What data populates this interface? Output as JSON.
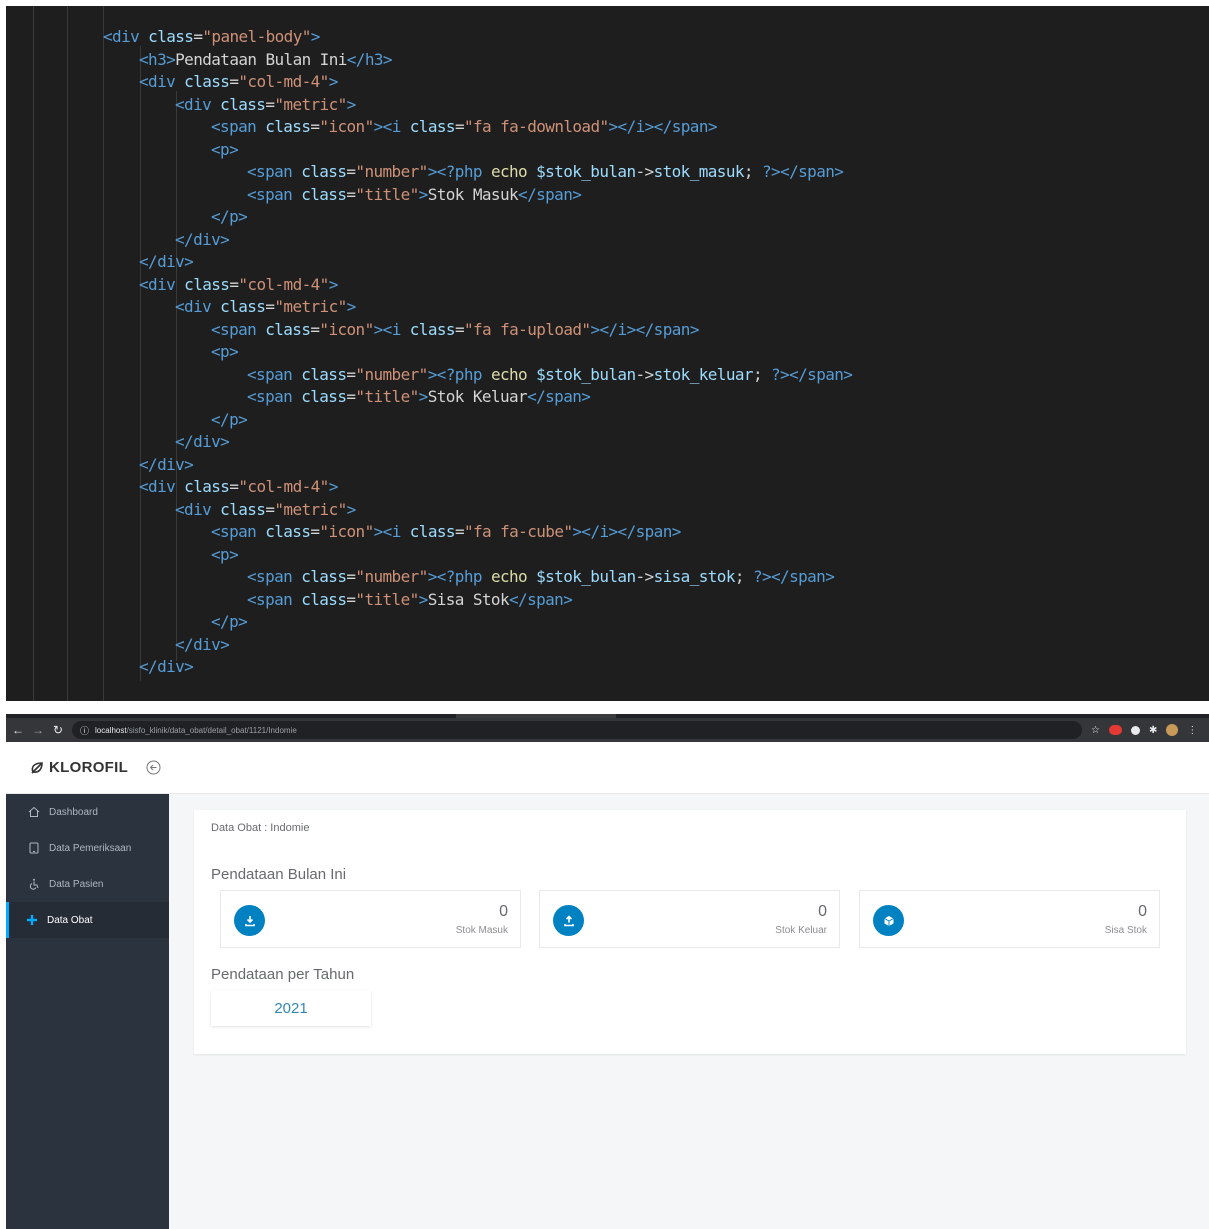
{
  "editor": {
    "lines": [
      [
        [
          "tok-tag",
          "<div "
        ],
        [
          "tok-attr",
          "class"
        ],
        [
          "tok-txt",
          "="
        ],
        [
          "tok-str",
          "\"panel-body\""
        ],
        [
          "tok-tag",
          ">"
        ]
      ],
      [
        [
          "tok-tag",
          "<h3>"
        ],
        [
          "tok-txt",
          "Pendataan Bulan Ini"
        ],
        [
          "tok-tag",
          "</h3>"
        ]
      ],
      [
        [
          "tok-tag",
          "<div "
        ],
        [
          "tok-attr",
          "class"
        ],
        [
          "tok-txt",
          "="
        ],
        [
          "tok-str",
          "\"col-md-4\""
        ],
        [
          "tok-tag",
          ">"
        ]
      ],
      [
        [
          "tok-tag",
          "<div "
        ],
        [
          "tok-attr",
          "class"
        ],
        [
          "tok-txt",
          "="
        ],
        [
          "tok-str",
          "\"metric\""
        ],
        [
          "tok-tag",
          ">"
        ]
      ],
      [
        [
          "tok-tag",
          "<span "
        ],
        [
          "tok-attr",
          "class"
        ],
        [
          "tok-txt",
          "="
        ],
        [
          "tok-str",
          "\"icon\""
        ],
        [
          "tok-tag",
          "><i "
        ],
        [
          "tok-attr",
          "class"
        ],
        [
          "tok-txt",
          "="
        ],
        [
          "tok-str",
          "\"fa fa-download\""
        ],
        [
          "tok-tag",
          "></i></span>"
        ]
      ],
      [
        [
          "tok-tag",
          "<p>"
        ]
      ],
      [
        [
          "tok-tag",
          "<span "
        ],
        [
          "tok-attr",
          "class"
        ],
        [
          "tok-txt",
          "="
        ],
        [
          "tok-str",
          "\"number\""
        ],
        [
          "tok-tag",
          ">"
        ],
        [
          "tok-php",
          "<?php "
        ],
        [
          "tok-fn",
          "echo "
        ],
        [
          "tok-var",
          "$stok_bulan"
        ],
        [
          "tok-txt",
          "->"
        ],
        [
          "tok-var",
          "stok_masuk"
        ],
        [
          "tok-txt",
          "; "
        ],
        [
          "tok-php",
          "?>"
        ],
        [
          "tok-tag",
          "</span>"
        ]
      ],
      [
        [
          "tok-tag",
          "<span "
        ],
        [
          "tok-attr",
          "class"
        ],
        [
          "tok-txt",
          "="
        ],
        [
          "tok-str",
          "\"title\""
        ],
        [
          "tok-tag",
          ">"
        ],
        [
          "tok-txt",
          "Stok Masuk"
        ],
        [
          "tok-tag",
          "</span>"
        ]
      ],
      [
        [
          "tok-tag",
          "</p>"
        ]
      ],
      [
        [
          "tok-tag",
          "</div>"
        ]
      ],
      [
        [
          "tok-tag",
          "</div>"
        ]
      ],
      [
        [
          "tok-tag",
          "<div "
        ],
        [
          "tok-attr",
          "class"
        ],
        [
          "tok-txt",
          "="
        ],
        [
          "tok-str",
          "\"col-md-4\""
        ],
        [
          "tok-tag",
          ">"
        ]
      ],
      [
        [
          "tok-tag",
          "<div "
        ],
        [
          "tok-attr",
          "class"
        ],
        [
          "tok-txt",
          "="
        ],
        [
          "tok-str",
          "\"metric\""
        ],
        [
          "tok-tag",
          ">"
        ]
      ],
      [
        [
          "tok-tag",
          "<span "
        ],
        [
          "tok-attr",
          "class"
        ],
        [
          "tok-txt",
          "="
        ],
        [
          "tok-str",
          "\"icon\""
        ],
        [
          "tok-tag",
          "><i "
        ],
        [
          "tok-attr",
          "class"
        ],
        [
          "tok-txt",
          "="
        ],
        [
          "tok-str",
          "\"fa fa-upload\""
        ],
        [
          "tok-tag",
          "></i></span>"
        ]
      ],
      [
        [
          "tok-tag",
          "<p>"
        ]
      ],
      [
        [
          "tok-tag",
          "<span "
        ],
        [
          "tok-attr",
          "class"
        ],
        [
          "tok-txt",
          "="
        ],
        [
          "tok-str",
          "\"number\""
        ],
        [
          "tok-tag",
          ">"
        ],
        [
          "tok-php",
          "<?php "
        ],
        [
          "tok-fn",
          "echo "
        ],
        [
          "tok-var",
          "$stok_bulan"
        ],
        [
          "tok-txt",
          "->"
        ],
        [
          "tok-var",
          "stok_keluar"
        ],
        [
          "tok-txt",
          "; "
        ],
        [
          "tok-php",
          "?>"
        ],
        [
          "tok-tag",
          "</span>"
        ]
      ],
      [
        [
          "tok-tag",
          "<span "
        ],
        [
          "tok-attr",
          "class"
        ],
        [
          "tok-txt",
          "="
        ],
        [
          "tok-str",
          "\"title\""
        ],
        [
          "tok-tag",
          ">"
        ],
        [
          "tok-txt",
          "Stok Keluar"
        ],
        [
          "tok-tag",
          "</span>"
        ]
      ],
      [
        [
          "tok-tag",
          "</p>"
        ]
      ],
      [
        [
          "tok-tag",
          "</div>"
        ]
      ],
      [
        [
          "tok-tag",
          "</div>"
        ]
      ],
      [
        [
          "tok-tag",
          "<div "
        ],
        [
          "tok-attr",
          "class"
        ],
        [
          "tok-txt",
          "="
        ],
        [
          "tok-str",
          "\"col-md-4\""
        ],
        [
          "tok-tag",
          ">"
        ]
      ],
      [
        [
          "tok-tag",
          "<div "
        ],
        [
          "tok-attr",
          "class"
        ],
        [
          "tok-txt",
          "="
        ],
        [
          "tok-str",
          "\"metric\""
        ],
        [
          "tok-tag",
          ">"
        ]
      ],
      [
        [
          "tok-tag",
          "<span "
        ],
        [
          "tok-attr",
          "class"
        ],
        [
          "tok-txt",
          "="
        ],
        [
          "tok-str",
          "\"icon\""
        ],
        [
          "tok-tag",
          "><i "
        ],
        [
          "tok-attr",
          "class"
        ],
        [
          "tok-txt",
          "="
        ],
        [
          "tok-str",
          "\"fa fa-cube\""
        ],
        [
          "tok-tag",
          "></i></span>"
        ]
      ],
      [
        [
          "tok-tag",
          "<p>"
        ]
      ],
      [
        [
          "tok-tag",
          "<span "
        ],
        [
          "tok-attr",
          "class"
        ],
        [
          "tok-txt",
          "="
        ],
        [
          "tok-str",
          "\"number\""
        ],
        [
          "tok-tag",
          ">"
        ],
        [
          "tok-php",
          "<?php "
        ],
        [
          "tok-fn",
          "echo "
        ],
        [
          "tok-var",
          "$stok_bulan"
        ],
        [
          "tok-txt",
          "->"
        ],
        [
          "tok-var",
          "sisa_stok"
        ],
        [
          "tok-txt",
          "; "
        ],
        [
          "tok-php",
          "?>"
        ],
        [
          "tok-tag",
          "</span>"
        ]
      ],
      [
        [
          "tok-tag",
          "<span "
        ],
        [
          "tok-attr",
          "class"
        ],
        [
          "tok-txt",
          "="
        ],
        [
          "tok-str",
          "\"title\""
        ],
        [
          "tok-tag",
          ">"
        ],
        [
          "tok-txt",
          "Sisa Stok"
        ],
        [
          "tok-tag",
          "</span>"
        ]
      ],
      [
        [
          "tok-tag",
          "</p>"
        ]
      ],
      [
        [
          "tok-tag",
          "</div>"
        ]
      ],
      [
        [
          "tok-tag",
          "</div>"
        ]
      ]
    ]
  },
  "browser": {
    "url_host": "localhost",
    "url_path": "/sisfo_klinik/data_obat/detail_obat/1121/Indomie",
    "brand": "KLOROFIL"
  },
  "sidebar": {
    "items": [
      {
        "label": "Dashboard",
        "icon": "home-icon",
        "active": false
      },
      {
        "label": "Data Pemeriksaan",
        "icon": "tablet-icon",
        "active": false
      },
      {
        "label": "Data Pasien",
        "icon": "wheelchair-icon",
        "active": false
      },
      {
        "label": "Data Obat",
        "icon": "plus-icon",
        "active": true
      }
    ]
  },
  "main": {
    "panel_heading": "Data Obat : Indomie",
    "month_title": "Pendataan Bulan Ini",
    "metrics": [
      {
        "icon": "download-icon",
        "number": "0",
        "title": "Stok Masuk"
      },
      {
        "icon": "upload-icon",
        "number": "0",
        "title": "Stok Keluar"
      },
      {
        "icon": "cube-icon",
        "number": "0",
        "title": "Sisa Stok"
      }
    ],
    "year_title": "Pendataan per Tahun",
    "year_value": "2021"
  },
  "colors": {
    "accent": "#0081c2",
    "sidebar_bg": "#2b333e",
    "sidebar_active_bar": "#00aaff",
    "editor_bg": "#1e1e1e"
  }
}
